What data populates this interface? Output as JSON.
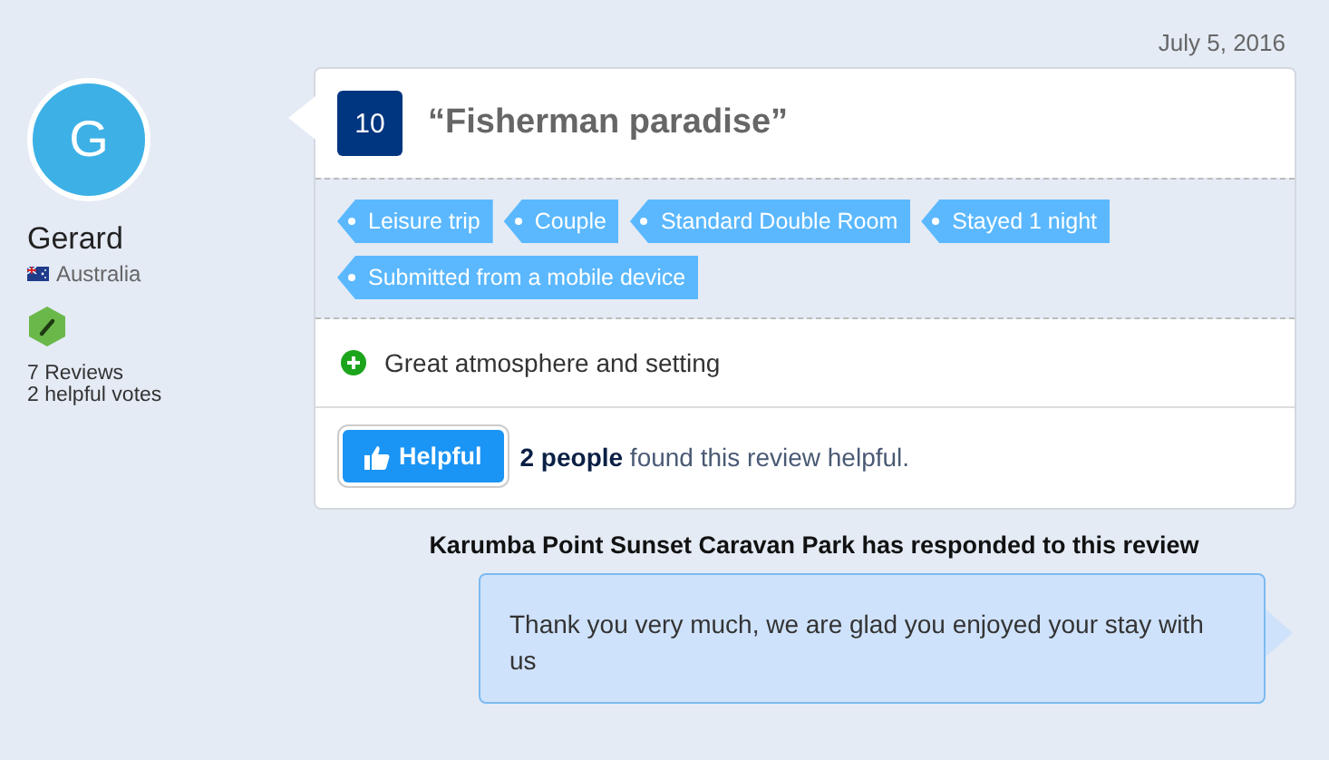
{
  "date": "July 5, 2016",
  "reviewer": {
    "initial": "G",
    "name": "Gerard",
    "country": "Australia",
    "reviews": "7 Reviews",
    "helpful_votes": "2 helpful votes"
  },
  "review": {
    "score": "10",
    "title": "“Fisherman paradise”",
    "tags": [
      "Leisure trip",
      "Couple",
      "Standard Double Room",
      "Stayed 1 night",
      "Submitted from a mobile device"
    ],
    "pros": [
      "Great atmosphere and setting"
    ],
    "helpful_button": "Helpful",
    "helpful_text": "**2 people** found this review helpful."
  },
  "response": {
    "title": "Karumba Point Sunset Caravan Park has responded to this review",
    "text": "Thank you very much, we are glad you enjoyed your stay with us"
  }
}
